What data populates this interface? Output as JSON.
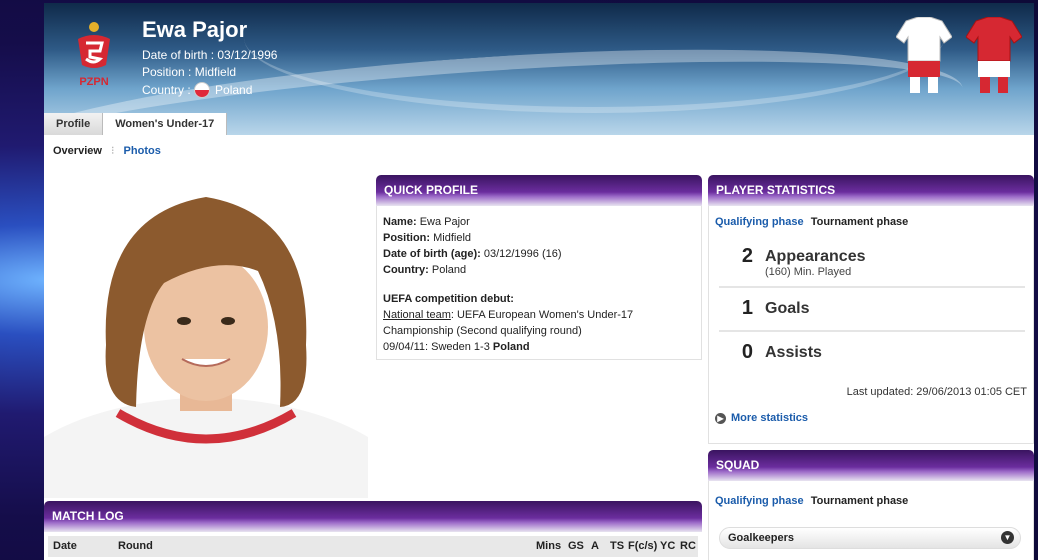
{
  "player": {
    "name": "Ewa Pajor",
    "dob_line": "Date of birth : 03/12/1996",
    "position_line": "Position : Midfield",
    "country_label": "Country :",
    "country": "Poland",
    "logo_text": "PZPN"
  },
  "tabs": [
    {
      "label": "Profile"
    },
    {
      "label": "Women's Under-17"
    }
  ],
  "subnav": {
    "overview": "Overview",
    "sep": "⁝",
    "photos": "Photos"
  },
  "quick_profile": {
    "title": "QUICK PROFILE",
    "name_label": "Name:",
    "name": "Ewa Pajor",
    "position_label": "Position:",
    "position": "Midfield",
    "dob_label": "Date of birth (age):",
    "dob": "03/12/1996 (16)",
    "country_label": "Country:",
    "country": "Poland",
    "debut_label": "UEFA competition debut:",
    "debut_team_label": "National team",
    "debut_comp": ": UEFA European Women's Under-17",
    "debut_comp2": "Championship (Second qualifying round)",
    "debut_match_pre": "09/04/11: Sweden 1-3 ",
    "debut_match_team": "Poland"
  },
  "player_stats": {
    "title": "PLAYER STATISTICS",
    "phase1": "Qualifying phase",
    "phase2": "Tournament phase",
    "stats": [
      {
        "n": "2",
        "label": "Appearances",
        "sub": "(160) Min. Played"
      },
      {
        "n": "1",
        "label": "Goals"
      },
      {
        "n": "0",
        "label": "Assists"
      }
    ],
    "updated": "Last updated: 29/06/2013 01:05 CET",
    "more": "More statistics"
  },
  "squad": {
    "title": "SQUAD",
    "phase1": "Qualifying phase",
    "phase2": "Tournament phase",
    "group": "Goalkeepers"
  },
  "match_log": {
    "title": "MATCH LOG",
    "cols": [
      "Date",
      "Round",
      "Mins",
      "GS",
      "A",
      "TS",
      "F(c/s)",
      "YC",
      "RC"
    ]
  },
  "colors": {
    "accent": "#1b5cab",
    "header_purple": "#6b2d9e",
    "flag_red": "#e0283a"
  }
}
